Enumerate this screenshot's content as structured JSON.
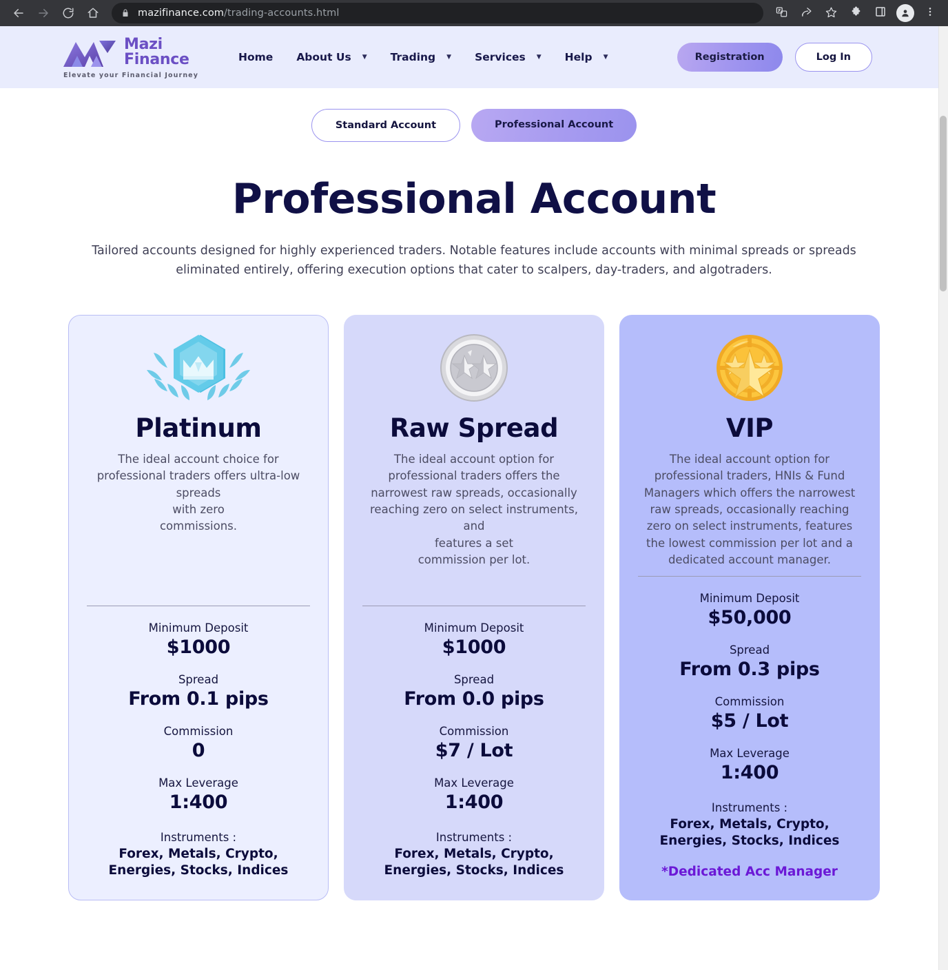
{
  "browser": {
    "back_icon": "back-arrow-icon",
    "forward_icon": "forward-arrow-icon",
    "reload_icon": "reload-icon",
    "home_icon": "home-icon",
    "lock_icon": "lock-icon",
    "url_host": "mazifinance.com",
    "url_path": "/trading-accounts.html",
    "translate_icon": "translate-icon",
    "share_icon": "share-icon",
    "bookmark_icon": "star-icon",
    "extensions_icon": "puzzle-icon",
    "sidepanel_icon": "side-panel-icon",
    "profile_icon": "profile-avatar-icon",
    "menu_icon": "three-dot-menu-icon"
  },
  "header": {
    "logo_name": "Mazi",
    "logo_name2": "Finance",
    "tagline": "Elevate your Financial Journey",
    "nav": [
      {
        "label": "Home",
        "has_caret": false
      },
      {
        "label": "About Us",
        "has_caret": true
      },
      {
        "label": "Trading",
        "has_caret": true
      },
      {
        "label": "Services",
        "has_caret": true
      },
      {
        "label": "Help",
        "has_caret": true
      }
    ],
    "register_label": "Registration",
    "login_label": "Log In"
  },
  "toggle": {
    "standard_label": "Standard Account",
    "professional_label": "Professional Account",
    "active": "Professional Account"
  },
  "page": {
    "title": "Professional Account",
    "description": "Tailored accounts designed for highly experienced traders. Notable features include accounts with minimal spreads or spreads eliminated entirely, offering execution options that cater to scalpers, day-traders, and algotraders."
  },
  "labels": {
    "min_deposit": "Minimum Deposit",
    "spread": "Spread",
    "commission": "Commission",
    "max_leverage": "Max Leverage",
    "instruments": "Instruments :"
  },
  "cards": [
    {
      "badge_icon": "platinum-crown-badge-icon",
      "title": "Platinum",
      "description": "The ideal account choice for professional traders offers ultra-low spreads\nwith zero\ncommissions.",
      "min_deposit": "$1000",
      "spread": "From 0.1 pips",
      "commission": "0",
      "max_leverage": "1:400",
      "instruments": "Forex, Metals, Crypto,\nEnergies, Stocks, Indices",
      "note": ""
    },
    {
      "badge_icon": "silver-two-star-coin-icon",
      "title": "Raw Spread",
      "description": "The ideal account option for professional traders offers the narrowest raw spreads, occasionally reaching zero on select instruments, and\nfeatures a set\ncommission per lot.",
      "min_deposit": "$1000",
      "spread": "From 0.0 pips",
      "commission": "$7 / Lot",
      "max_leverage": "1:400",
      "instruments": "Forex, Metals, Crypto,\nEnergies, Stocks, Indices",
      "note": ""
    },
    {
      "badge_icon": "gold-three-star-coin-icon",
      "title": "VIP",
      "description": "The ideal account option for professional traders, HNIs & Fund Managers which offers the narrowest raw spreads, occasionally reaching zero on select instruments, features the lowest commission per lot and a dedicated account manager.",
      "min_deposit": "$50,000",
      "spread": "From 0.3 pips",
      "commission": "$5 / Lot",
      "max_leverage": "1:400",
      "instruments": "Forex, Metals, Crypto,\nEnergies, Stocks, Indices",
      "note": "*Dedicated Acc Manager"
    }
  ],
  "colors": {
    "brand_purple": "#6b4fc4",
    "accent_violet": "#6b18d6",
    "header_bg": "#e9ecfd",
    "card_platinum_bg": "#ecefff",
    "card_raw_bg": "#d6d9fa",
    "card_vip_bg": "#b5bdfb",
    "title_navy": "#101046"
  }
}
